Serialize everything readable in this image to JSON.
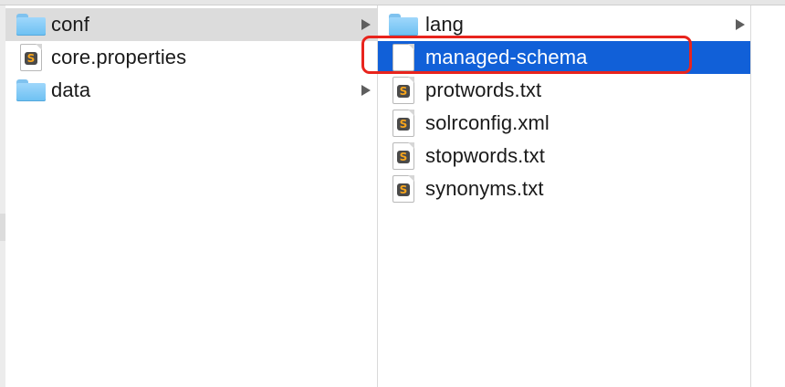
{
  "column1": {
    "items": [
      {
        "name": "conf",
        "type": "folder",
        "icon": "folder-icon",
        "has_children": true,
        "state": "selected-inactive"
      },
      {
        "name": "core.properties",
        "type": "file",
        "icon": "sublime-file-icon",
        "has_children": false,
        "state": "none"
      },
      {
        "name": "data",
        "type": "folder",
        "icon": "folder-icon",
        "has_children": true,
        "state": "none"
      }
    ]
  },
  "column2": {
    "items": [
      {
        "name": "lang",
        "type": "folder",
        "icon": "folder-icon",
        "has_children": true,
        "state": "none"
      },
      {
        "name": "managed-schema",
        "type": "file",
        "icon": "blank-document-icon",
        "has_children": false,
        "state": "selected-active"
      },
      {
        "name": "protwords.txt",
        "type": "file",
        "icon": "sublime-file-icon",
        "has_children": false,
        "state": "none"
      },
      {
        "name": "solrconfig.xml",
        "type": "file",
        "icon": "sublime-file-icon",
        "has_children": false,
        "state": "none"
      },
      {
        "name": "stopwords.txt",
        "type": "file",
        "icon": "sublime-file-icon",
        "has_children": false,
        "state": "none"
      },
      {
        "name": "synonyms.txt",
        "type": "file",
        "icon": "sublime-file-icon",
        "has_children": false,
        "state": "none"
      }
    ]
  },
  "annotation": {
    "target": "managed-schema",
    "color": "#e8241d"
  },
  "colors": {
    "selection_active": "#1160d8",
    "selection_inactive": "#dcdcdc",
    "folder": "#7cc6f5"
  }
}
